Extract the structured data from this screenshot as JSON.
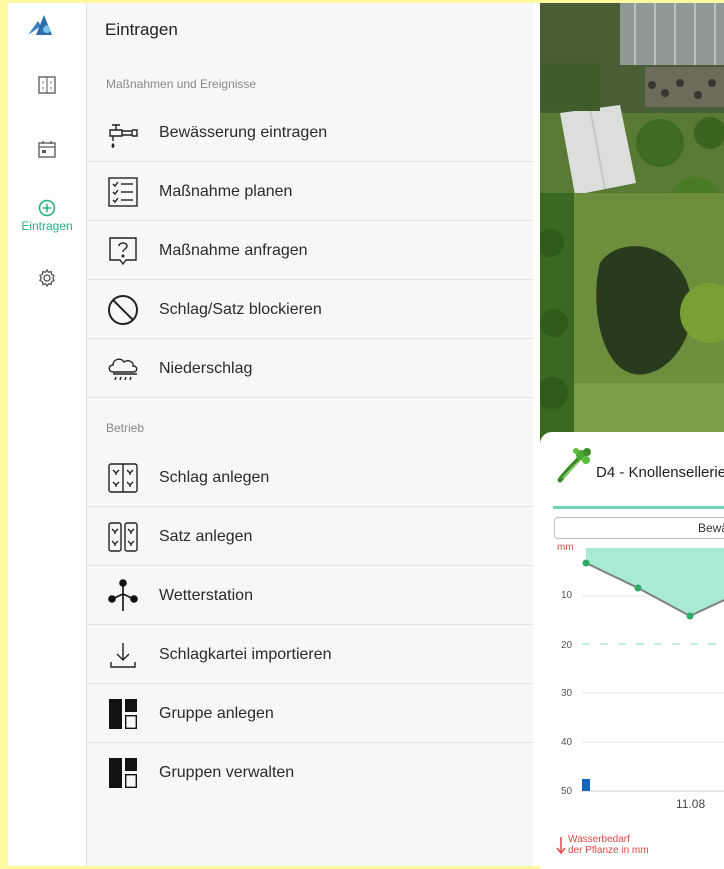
{
  "rail": {
    "items": [
      {
        "id": "beds",
        "icon": "beds-icon"
      },
      {
        "id": "calendar",
        "icon": "calendar-icon"
      },
      {
        "id": "add",
        "icon": "add-circle-icon",
        "label": "Eintragen",
        "active": true
      },
      {
        "id": "settings",
        "icon": "gear-icon"
      }
    ],
    "accent": "#1fb37a"
  },
  "panel": {
    "title": "Eintragen",
    "section_measures": "Maßnahmen und Ereignisse",
    "section_operation": "Betrieb",
    "measures": [
      {
        "label": "Bewässerung eintragen",
        "icon": "faucet-icon"
      },
      {
        "label": "Maßnahme planen",
        "icon": "checklist-icon"
      },
      {
        "label": "Maßnahme anfragen",
        "icon": "question-box-icon"
      },
      {
        "label": "Schlag/Satz blockieren",
        "icon": "block-icon"
      },
      {
        "label": "Niederschlag",
        "icon": "rain-cloud-icon"
      }
    ],
    "operation": [
      {
        "label": "Schlag anlegen",
        "icon": "plot-icon"
      },
      {
        "label": "Satz anlegen",
        "icon": "set-icon"
      },
      {
        "label": "Wetterstation",
        "icon": "weather-station-icon"
      },
      {
        "label": "Schlagkartei importieren",
        "icon": "import-icon"
      },
      {
        "label": "Gruppe anlegen",
        "icon": "group-add-icon"
      },
      {
        "label": "Gruppen verwalten",
        "icon": "group-manage-icon"
      }
    ]
  },
  "card": {
    "title": "D4 - Knollensellerie",
    "toggle_label": "Bewässerung",
    "chart_unit": "mm",
    "chart_ticks": [
      "10",
      "20",
      "30",
      "40",
      "50"
    ],
    "x_label": "11.08",
    "legend_line1": "Wasserbedarf",
    "legend_line2": "der Pflanze in mm",
    "colors": {
      "fill": "#a8ead3",
      "line": "#808080",
      "point": "#2eaa68",
      "bar": "#1565c0",
      "legend": "#e04848"
    }
  }
}
